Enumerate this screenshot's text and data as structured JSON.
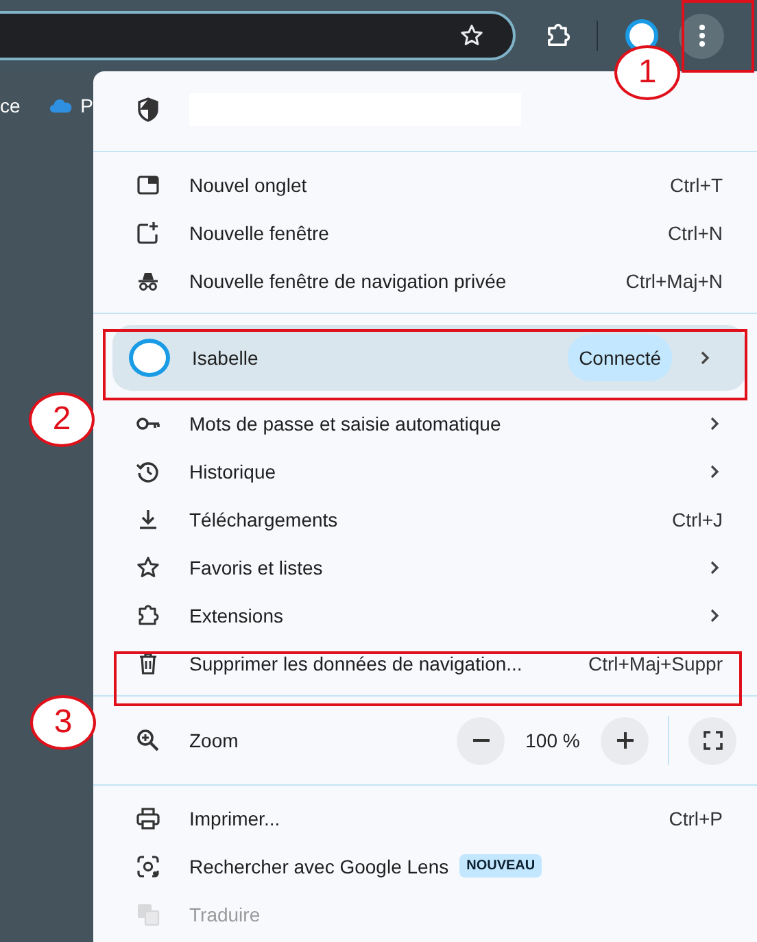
{
  "toolbar": {
    "bookmarks": [
      "ce",
      "P"
    ]
  },
  "menu": {
    "items": [
      {
        "kind": "header"
      },
      {
        "kind": "divider"
      },
      {
        "kind": "item",
        "label": "Nouvel onglet",
        "shortcut": "Ctrl+T",
        "submenu": false,
        "disabled": false
      },
      {
        "kind": "item",
        "label": "Nouvelle fenêtre",
        "shortcut": "Ctrl+N",
        "submenu": false,
        "disabled": false
      },
      {
        "kind": "item",
        "label": "Nouvelle fenêtre de navigation privée",
        "shortcut": "Ctrl+Maj+N",
        "submenu": false,
        "disabled": false
      },
      {
        "kind": "divider"
      },
      {
        "kind": "profile",
        "label": "Isabelle",
        "status": "Connecté",
        "submenu": true
      },
      {
        "kind": "item",
        "label": "Mots de passe et saisie automatique",
        "submenu": true,
        "disabled": false
      },
      {
        "kind": "item",
        "label": "Historique",
        "submenu": true,
        "disabled": false
      },
      {
        "kind": "item",
        "label": "Téléchargements",
        "shortcut": "Ctrl+J",
        "submenu": false,
        "disabled": false
      },
      {
        "kind": "item",
        "label": "Favoris et listes",
        "submenu": true,
        "disabled": false
      },
      {
        "kind": "item",
        "label": "Extensions",
        "submenu": true,
        "disabled": false
      },
      {
        "kind": "item",
        "label": "Supprimer les données de navigation...",
        "shortcut": "Ctrl+Maj+Suppr",
        "submenu": false,
        "disabled": false
      },
      {
        "kind": "divider"
      },
      {
        "kind": "zoom",
        "label": "Zoom",
        "value": "100 %"
      },
      {
        "kind": "divider"
      },
      {
        "kind": "item",
        "label": "Imprimer...",
        "shortcut": "Ctrl+P",
        "submenu": false,
        "disabled": false
      },
      {
        "kind": "item",
        "label": "Rechercher avec Google Lens",
        "badge": "NOUVEAU",
        "submenu": false,
        "disabled": false
      },
      {
        "kind": "item",
        "label": "Traduire",
        "submenu": false,
        "disabled": true
      }
    ]
  },
  "annotations": [
    {
      "number": "1"
    },
    {
      "number": "2"
    },
    {
      "number": "3"
    }
  ]
}
